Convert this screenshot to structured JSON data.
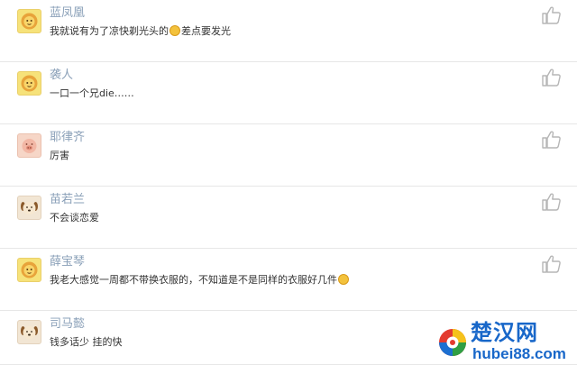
{
  "comments": [
    {
      "name": "蓝凤凰",
      "text_before": "我就说有为了凉快剃光头的",
      "text_after": "差点要发光",
      "avatar_icon": "lion-avatar-icon",
      "emoji_icon": "sweat-smile-emoji-icon"
    },
    {
      "name": "袭人",
      "text": "一口一个兄die……",
      "avatar_icon": "lion-avatar-icon"
    },
    {
      "name": "耶律齐",
      "text": "厉害",
      "avatar_icon": "pig-avatar-icon"
    },
    {
      "name": "苗若兰",
      "text": "不会谈恋爱",
      "avatar_icon": "dog-avatar-icon"
    },
    {
      "name": "薛宝琴",
      "text_before": "我老大感觉一周都不带换衣服的，不知道是不是同样的衣服好几件",
      "text_after": "",
      "avatar_icon": "lion-avatar-icon",
      "emoji_icon": "laughing-emoji-icon"
    },
    {
      "name": "司马懿",
      "text": "钱多话少 挂的快",
      "avatar_icon": "dog-avatar-icon"
    }
  ],
  "like_icon": "thumbs-up-icon",
  "watermark": {
    "title": "楚汉网",
    "url": "hubei88.com",
    "logo_icon": "chuhan-logo-icon"
  },
  "colors": {
    "name": "#8aa0b8",
    "text": "#333333",
    "divider": "#e7e7e7",
    "watermark": "#1867c9"
  }
}
